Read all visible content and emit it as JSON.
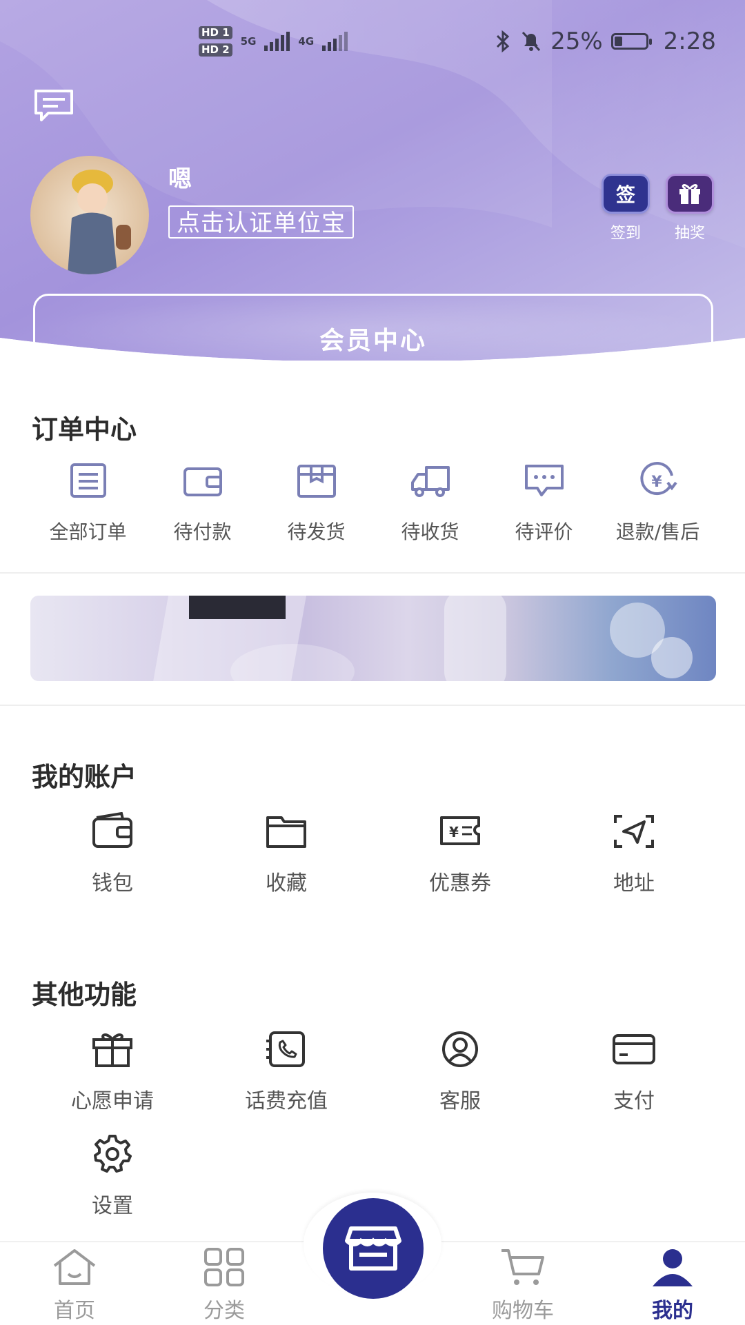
{
  "status_bar": {
    "hd1": "HD 1",
    "hd2": "HD 2",
    "net1": "5G",
    "net2": "4G",
    "battery_percent_text": "25%",
    "battery_level": 0.25,
    "time": "2:28"
  },
  "profile": {
    "name": "嗯",
    "verify_label": "点击认证单位宝",
    "sign_in": {
      "icon_text": "签",
      "label": "签到"
    },
    "lottery": {
      "label": "抽奖"
    },
    "member_center": "会员中心"
  },
  "orders": {
    "title": "订单中心",
    "items": [
      {
        "label": "全部订单",
        "icon": "list-icon"
      },
      {
        "label": "待付款",
        "icon": "wallet-icon"
      },
      {
        "label": "待发货",
        "icon": "package-icon"
      },
      {
        "label": "待收货",
        "icon": "truck-icon"
      },
      {
        "label": "待评价",
        "icon": "comment-icon"
      },
      {
        "label": "退款/售后",
        "icon": "refund-icon"
      }
    ]
  },
  "account": {
    "title": "我的账户",
    "items": [
      {
        "label": "钱包",
        "icon": "wallet-icon"
      },
      {
        "label": "收藏",
        "icon": "folder-icon"
      },
      {
        "label": "优惠券",
        "icon": "coupon-icon"
      },
      {
        "label": "地址",
        "icon": "location-icon"
      }
    ]
  },
  "other": {
    "title": "其他功能",
    "items": [
      {
        "label": "心愿申请",
        "icon": "gift-icon"
      },
      {
        "label": "话费充值",
        "icon": "phone-icon"
      },
      {
        "label": "客服",
        "icon": "support-icon"
      },
      {
        "label": "支付",
        "icon": "card-icon"
      },
      {
        "label": "设置",
        "icon": "gear-icon"
      }
    ]
  },
  "tabbar": {
    "items": [
      {
        "label": "首页",
        "icon": "home-icon"
      },
      {
        "label": "分类",
        "icon": "grid-icon"
      },
      {
        "label": "购物车",
        "icon": "cart-icon"
      },
      {
        "label": "我的",
        "icon": "user-icon"
      }
    ],
    "center_icon": "store-icon",
    "active": "我的"
  },
  "colors": {
    "header_gradient_start": "#a795dc",
    "header_gradient_end": "#c4bce9",
    "accent": "#2b2f8f",
    "icon_stroke": "#7a7fb5"
  }
}
